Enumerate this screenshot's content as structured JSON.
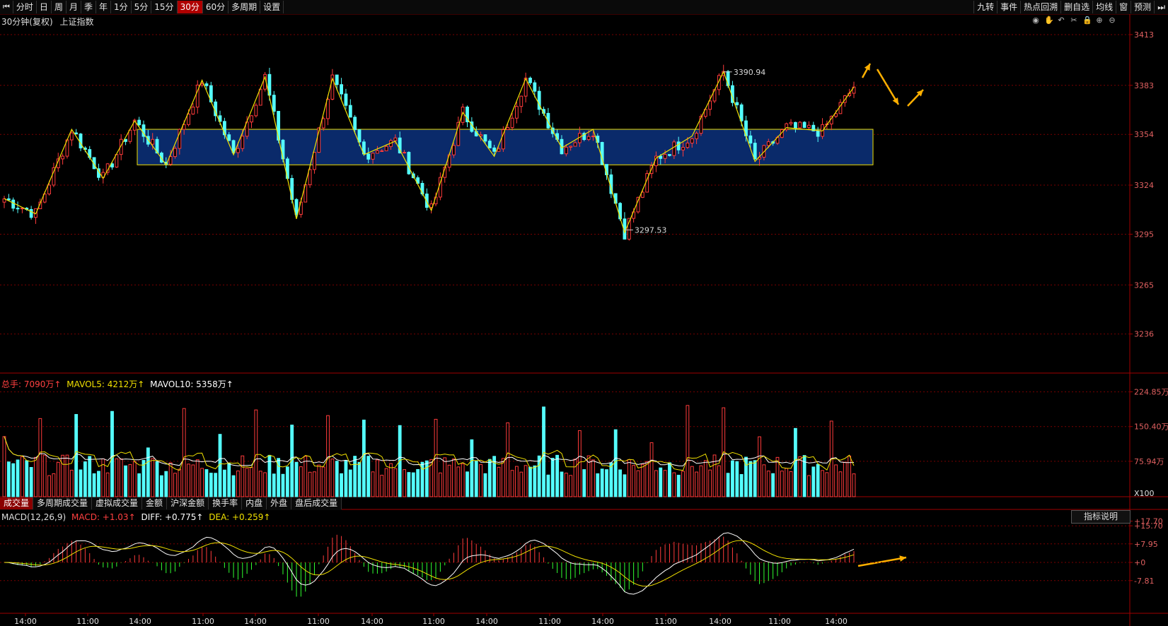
{
  "toolbar": {
    "nav_left_icon": "skip-back-icon",
    "periods": [
      "分时",
      "日",
      "周",
      "月",
      "季",
      "年",
      "1分",
      "5分",
      "15分",
      "30分",
      "60分",
      "多周期",
      "设置"
    ],
    "active_period": "30分",
    "right_tools": [
      "九转",
      "事件",
      "热点回溯",
      "删自选",
      "均线",
      "窗",
      "预测"
    ],
    "nav_right_icon": "skip-forward-icon"
  },
  "chart_header": {
    "period_label": "30分钟(复权)",
    "instrument": "上证指数"
  },
  "control_icons": [
    "eye-icon",
    "hand-icon",
    "undo-icon",
    "tools-icon",
    "lock-icon",
    "zoom-in-icon",
    "zoom-out-icon"
  ],
  "volume_header": {
    "total": "总手: 7090万↑",
    "mavol5": "MAVOL5: 4212万↑",
    "mavol10": "MAVOL10: 5358万↑"
  },
  "volume_tabs": [
    "成交量",
    "多周期成交量",
    "虚拟成交量",
    "金额",
    "沪深金额",
    "换手率",
    "内盘",
    "外盘",
    "盘后成交量"
  ],
  "macd_header": {
    "name": "MACD(12,26,9)",
    "macd": "MACD: +1.03↑",
    "diff": "DIFF: +0.775↑",
    "dea": "DEA: +0.259↑"
  },
  "macd_button": "指标说明",
  "colors": {
    "up": "#ff3b3b",
    "down": "#54ffff",
    "ma_white": "#ffffff",
    "ma_yellow": "#f0e000",
    "zone_fill": "#0a2a6a",
    "grid": "#7a0000",
    "arrow": "#ffb000"
  },
  "chart_data": [
    {
      "type": "candlestick",
      "y_axis_ticks": [
        3413,
        3383,
        3354,
        3324,
        3295,
        3265,
        3236
      ],
      "ylim": [
        3215,
        3423
      ],
      "x_labels": [
        "14:00",
        "11:00",
        "14:00",
        "11:00",
        "14:00",
        "11:00",
        "14:00",
        "11:00",
        "14:00",
        "11:00",
        "14:00",
        "11:00",
        "14:00",
        "11:00",
        "14:00"
      ],
      "zigzag": [
        3316,
        3307,
        3357,
        3328,
        3362,
        3336,
        3386,
        3342,
        3388,
        3304,
        3387,
        3342,
        3350,
        3309,
        3367,
        3341,
        3387,
        3346,
        3357,
        3296,
        3340,
        3353,
        3391,
        3338,
        3358,
        3356,
        3382
      ],
      "annotations": [
        {
          "label": "3390.94",
          "value": 3390.94
        },
        {
          "label": "3297.53",
          "value": 3297.53
        }
      ],
      "consolidation_zone": {
        "upper": 3357,
        "lower": 3336
      }
    },
    {
      "type": "bar",
      "name": "volume",
      "y_axis_ticks": [
        "224.85万",
        "150.40万",
        "75.94万"
      ],
      "unit_label": "X100",
      "ylim": [
        0,
        250
      ]
    },
    {
      "type": "bar",
      "name": "MACD",
      "y_axis_ticks": [
        "+17.70",
        "+15.70",
        "+7.95",
        "+0",
        "-7.81"
      ],
      "ylim": [
        -20,
        20
      ]
    }
  ]
}
